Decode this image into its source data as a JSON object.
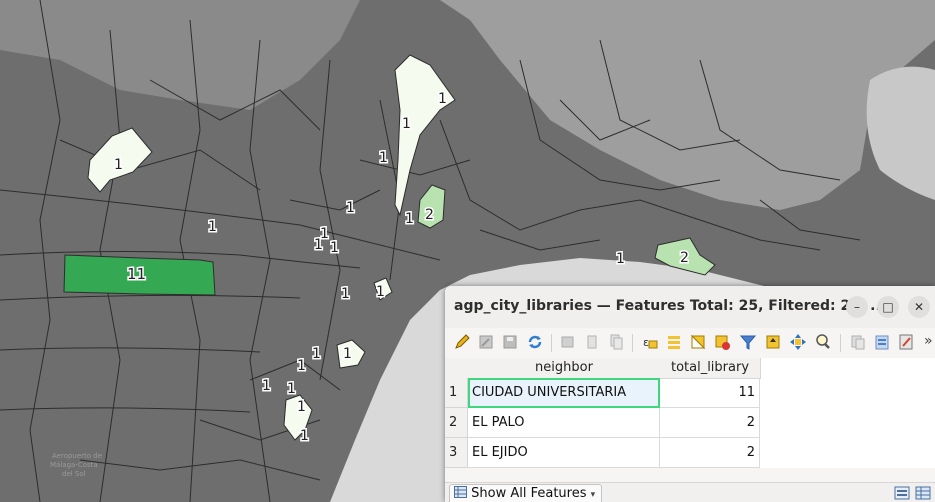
{
  "map": {
    "labels": [
      {
        "text": "11",
        "big": true
      },
      {
        "text": "1"
      },
      {
        "text": "1"
      },
      {
        "text": "1"
      },
      {
        "text": "1"
      },
      {
        "text": "1"
      },
      {
        "text": "1"
      },
      {
        "text": "1"
      },
      {
        "text": "2"
      },
      {
        "text": "1"
      },
      {
        "text": "1"
      },
      {
        "text": "1"
      },
      {
        "text": "1"
      },
      {
        "text": "1"
      },
      {
        "text": "1"
      },
      {
        "text": "1"
      },
      {
        "text": "1"
      },
      {
        "text": "1"
      },
      {
        "text": "1"
      },
      {
        "text": "1"
      },
      {
        "text": "1"
      },
      {
        "text": "2"
      },
      {
        "text": "1"
      }
    ],
    "airport_label_lines": [
      "Aeropuerto de",
      "Málaga-Costa",
      "del Sol"
    ],
    "colors": {
      "high": "#34a853",
      "mid": "#b9e2b1",
      "low": "#f6fbef",
      "land": "#6e6e6e",
      "sea": "#d9d9d9"
    }
  },
  "attribute_table": {
    "title": "agp_city_libraries — Features Total: 25, Filtered: 25, ...",
    "window_buttons": {
      "minimize": "–",
      "maximize": "□",
      "close": "✕"
    },
    "toolbar_icons": [
      "pencil-icon",
      "multi-edit-icon",
      "save-icon",
      "reload-icon",
      "add-feature-icon",
      "cut-icon",
      "copy-icon",
      "delete-icon",
      "expression-select-icon",
      "select-all-icon",
      "invert-selection-icon",
      "deselect-icon",
      "filter-icon",
      "move-top-icon",
      "pan-to-icon",
      "zoom-to-icon",
      "copy-rows-icon",
      "paste-icon",
      "field-calc-icon",
      "conditional-format-icon"
    ],
    "overflow": "»",
    "columns": [
      "neighbor",
      "total_library"
    ],
    "rows": [
      {
        "num": "1",
        "neighbor": "CIUDAD UNIVERSITARIA",
        "total_library": "11"
      },
      {
        "num": "2",
        "neighbor": "EL PALO",
        "total_library": "2"
      },
      {
        "num": "3",
        "neighbor": "EL EJIDO",
        "total_library": "2"
      }
    ],
    "show_all_label": "Show All Features"
  }
}
